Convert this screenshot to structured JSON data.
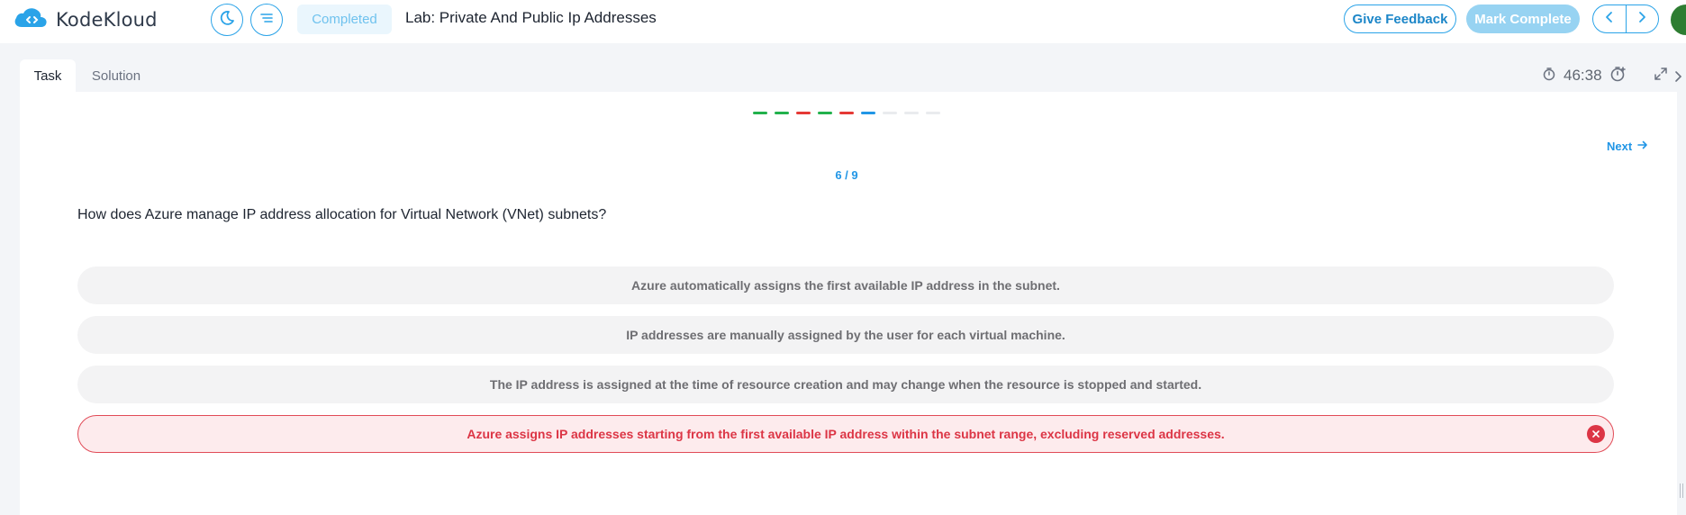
{
  "app": {
    "logo_text": "KodeKloud"
  },
  "header": {
    "status": "Completed",
    "lab_title": "Lab: Private And Public Ip Addresses",
    "feedback_label": "Give Feedback",
    "mark_complete_label": "Mark Complete"
  },
  "tabs": [
    {
      "label": "Task",
      "active": true
    },
    {
      "label": "Solution",
      "active": false
    }
  ],
  "timer": {
    "value": "46:38"
  },
  "progress": {
    "dash_colors": [
      "#22b14c",
      "#22b14c",
      "#e53935",
      "#22b14c",
      "#e53935",
      "#2196e6",
      "#e9ebee",
      "#e9ebee",
      "#e9ebee"
    ]
  },
  "quiz": {
    "next_label": "Next",
    "counter": "6 / 9",
    "question": "How does Azure manage IP address allocation for Virtual Network (VNet) subnets?",
    "options": [
      {
        "text": "Azure automatically assigns the first available IP address in the subnet.",
        "state": "neutral"
      },
      {
        "text": "IP addresses are manually assigned by the user for each virtual machine.",
        "state": "neutral"
      },
      {
        "text": "The IP address is assigned at the time of resource creation and may change when the resource is stopped and started.",
        "state": "neutral"
      },
      {
        "text": "Azure assigns IP addresses starting from the first available IP address within the subnet range, excluding reserved addresses.",
        "state": "wrong"
      }
    ]
  },
  "colors": {
    "accent": "#2aa3e8",
    "wrong": "#dc3545",
    "correct": "#22b14c"
  }
}
